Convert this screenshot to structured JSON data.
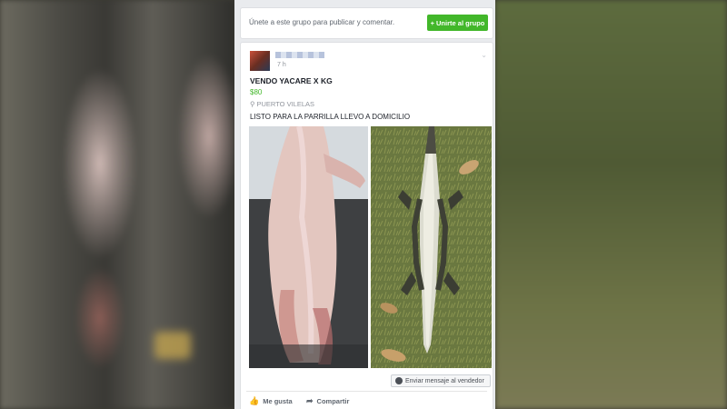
{
  "group": {
    "join_prompt": "Únete a este grupo para publicar y comentar.",
    "join_button": "Unirte al grupo",
    "join_icon": "plus-icon"
  },
  "post": {
    "timestamp": "7 h",
    "title": "VENDO YACARE X KG",
    "price": "$80",
    "location": "PUERTO VILELAS",
    "description": "LISTO PARA LA PARRILLA LLEVO A DOMICILIO",
    "message_button": "Enviar mensaje al vendedor"
  },
  "actions": {
    "like": "Me gusta",
    "share": "Compartir"
  },
  "colors": {
    "join_button": "#42b72a",
    "price": "#42b72a",
    "panel_bg": "#e9ebee"
  }
}
